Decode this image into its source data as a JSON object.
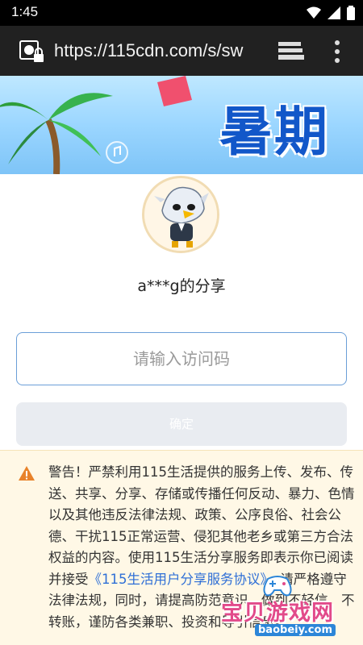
{
  "status_bar": {
    "time": "1:45"
  },
  "browser": {
    "url": "https://115cdn.com/s/sw"
  },
  "banner": {
    "text": "暑期"
  },
  "share": {
    "title": "a***g的分享"
  },
  "access": {
    "placeholder": "请输入访问码",
    "confirm_label": "确定"
  },
  "warning": {
    "text_before_link": "警告！严禁利用115生活提供的服务上传、发布、传送、共享、分享、存储或传播任何反动、暴力、色情以及其他违反法律法规、政策、公序良俗、社会公德、干扰115正常运营、侵犯其他老乡或第三方合法权益的内容。使用115生活分享服务即表示你已阅读并接受",
    "link_text": "《115生活用户分享服务协议》",
    "text_after_link": "，请严格遵守法律法规，同时，请提高防范意识，做到不轻信、不转账，谨防各类兼职、投资和导引信息。"
  },
  "watermark": {
    "text": "宝贝游戏网",
    "url": "baobeiy.com"
  },
  "colors": {
    "accent": "#2f6fd6",
    "warning_bg": "#fff8e6",
    "warning_icon": "#e8822a",
    "input_border": "#6b9fd8"
  }
}
